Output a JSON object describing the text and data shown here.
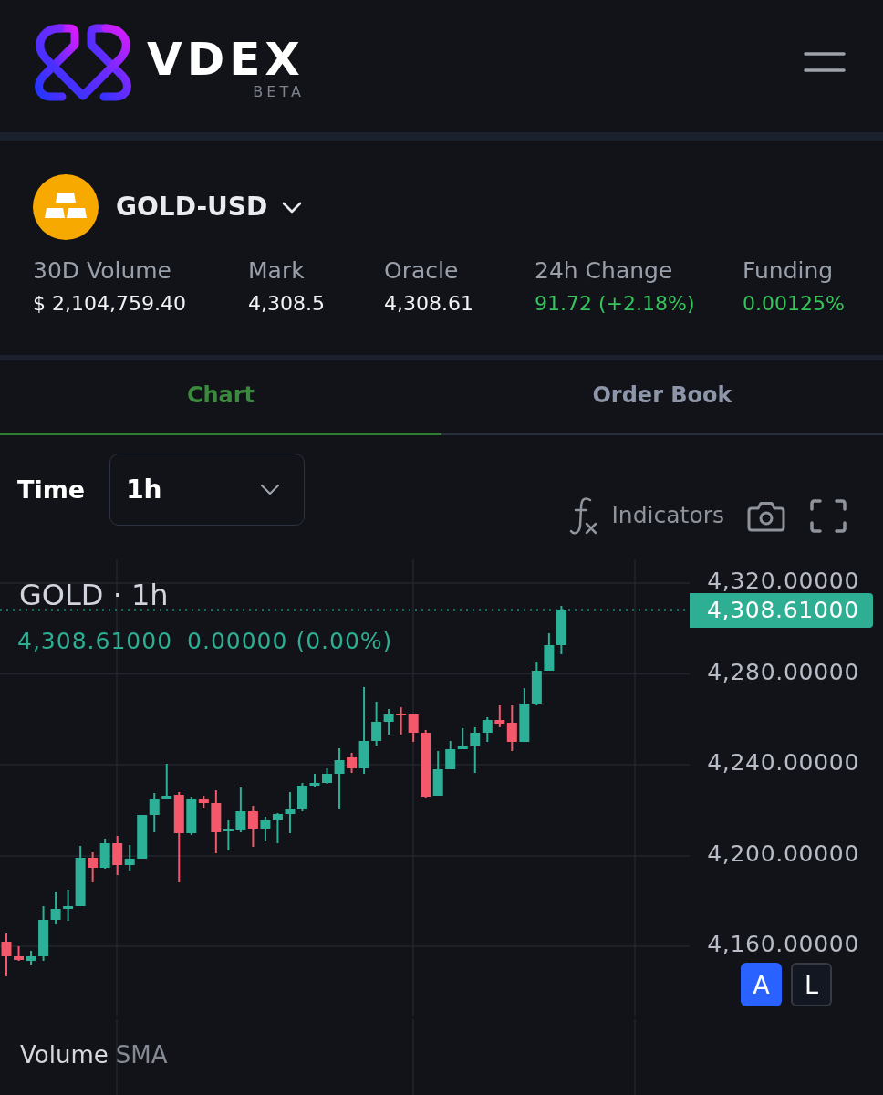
{
  "header": {
    "brand": "VDEX",
    "tag": "BETA"
  },
  "market": {
    "symbol": "GOLD-USD",
    "stats": [
      {
        "label": "30D Volume",
        "value": "$ 2,104,759.40",
        "kind": "plain"
      },
      {
        "label": "Mark",
        "value": "4,308.5",
        "kind": "plain"
      },
      {
        "label": "Oracle",
        "value": "4,308.61",
        "kind": "plain"
      },
      {
        "label": "24h Change",
        "value": "91.72 (+2.18%)",
        "kind": "positive"
      },
      {
        "label": "Funding",
        "value": "0.00125%",
        "kind": "positive"
      }
    ]
  },
  "tabs": [
    {
      "label": "Chart",
      "selected": true
    },
    {
      "label": "Order Book",
      "selected": false
    }
  ],
  "toolbar": {
    "time_label": "Time",
    "time_value": "1h",
    "indicators": "Indicators"
  },
  "chart": {
    "legend": {
      "title": "GOLD · 1h",
      "close": "4,308.61000",
      "change": "0.00000 (0.00%)"
    },
    "price_axis": [
      "4,320.00000",
      "4,280.00000",
      "4,240.00000",
      "4,200.00000",
      "4,160.00000"
    ],
    "last_price": "4,308.61000",
    "scale_buttons": [
      {
        "label": "A",
        "selected": true
      },
      {
        "label": "L",
        "selected": false
      }
    ],
    "volume_pane": {
      "title": "Volume",
      "study": "SMA"
    }
  }
}
